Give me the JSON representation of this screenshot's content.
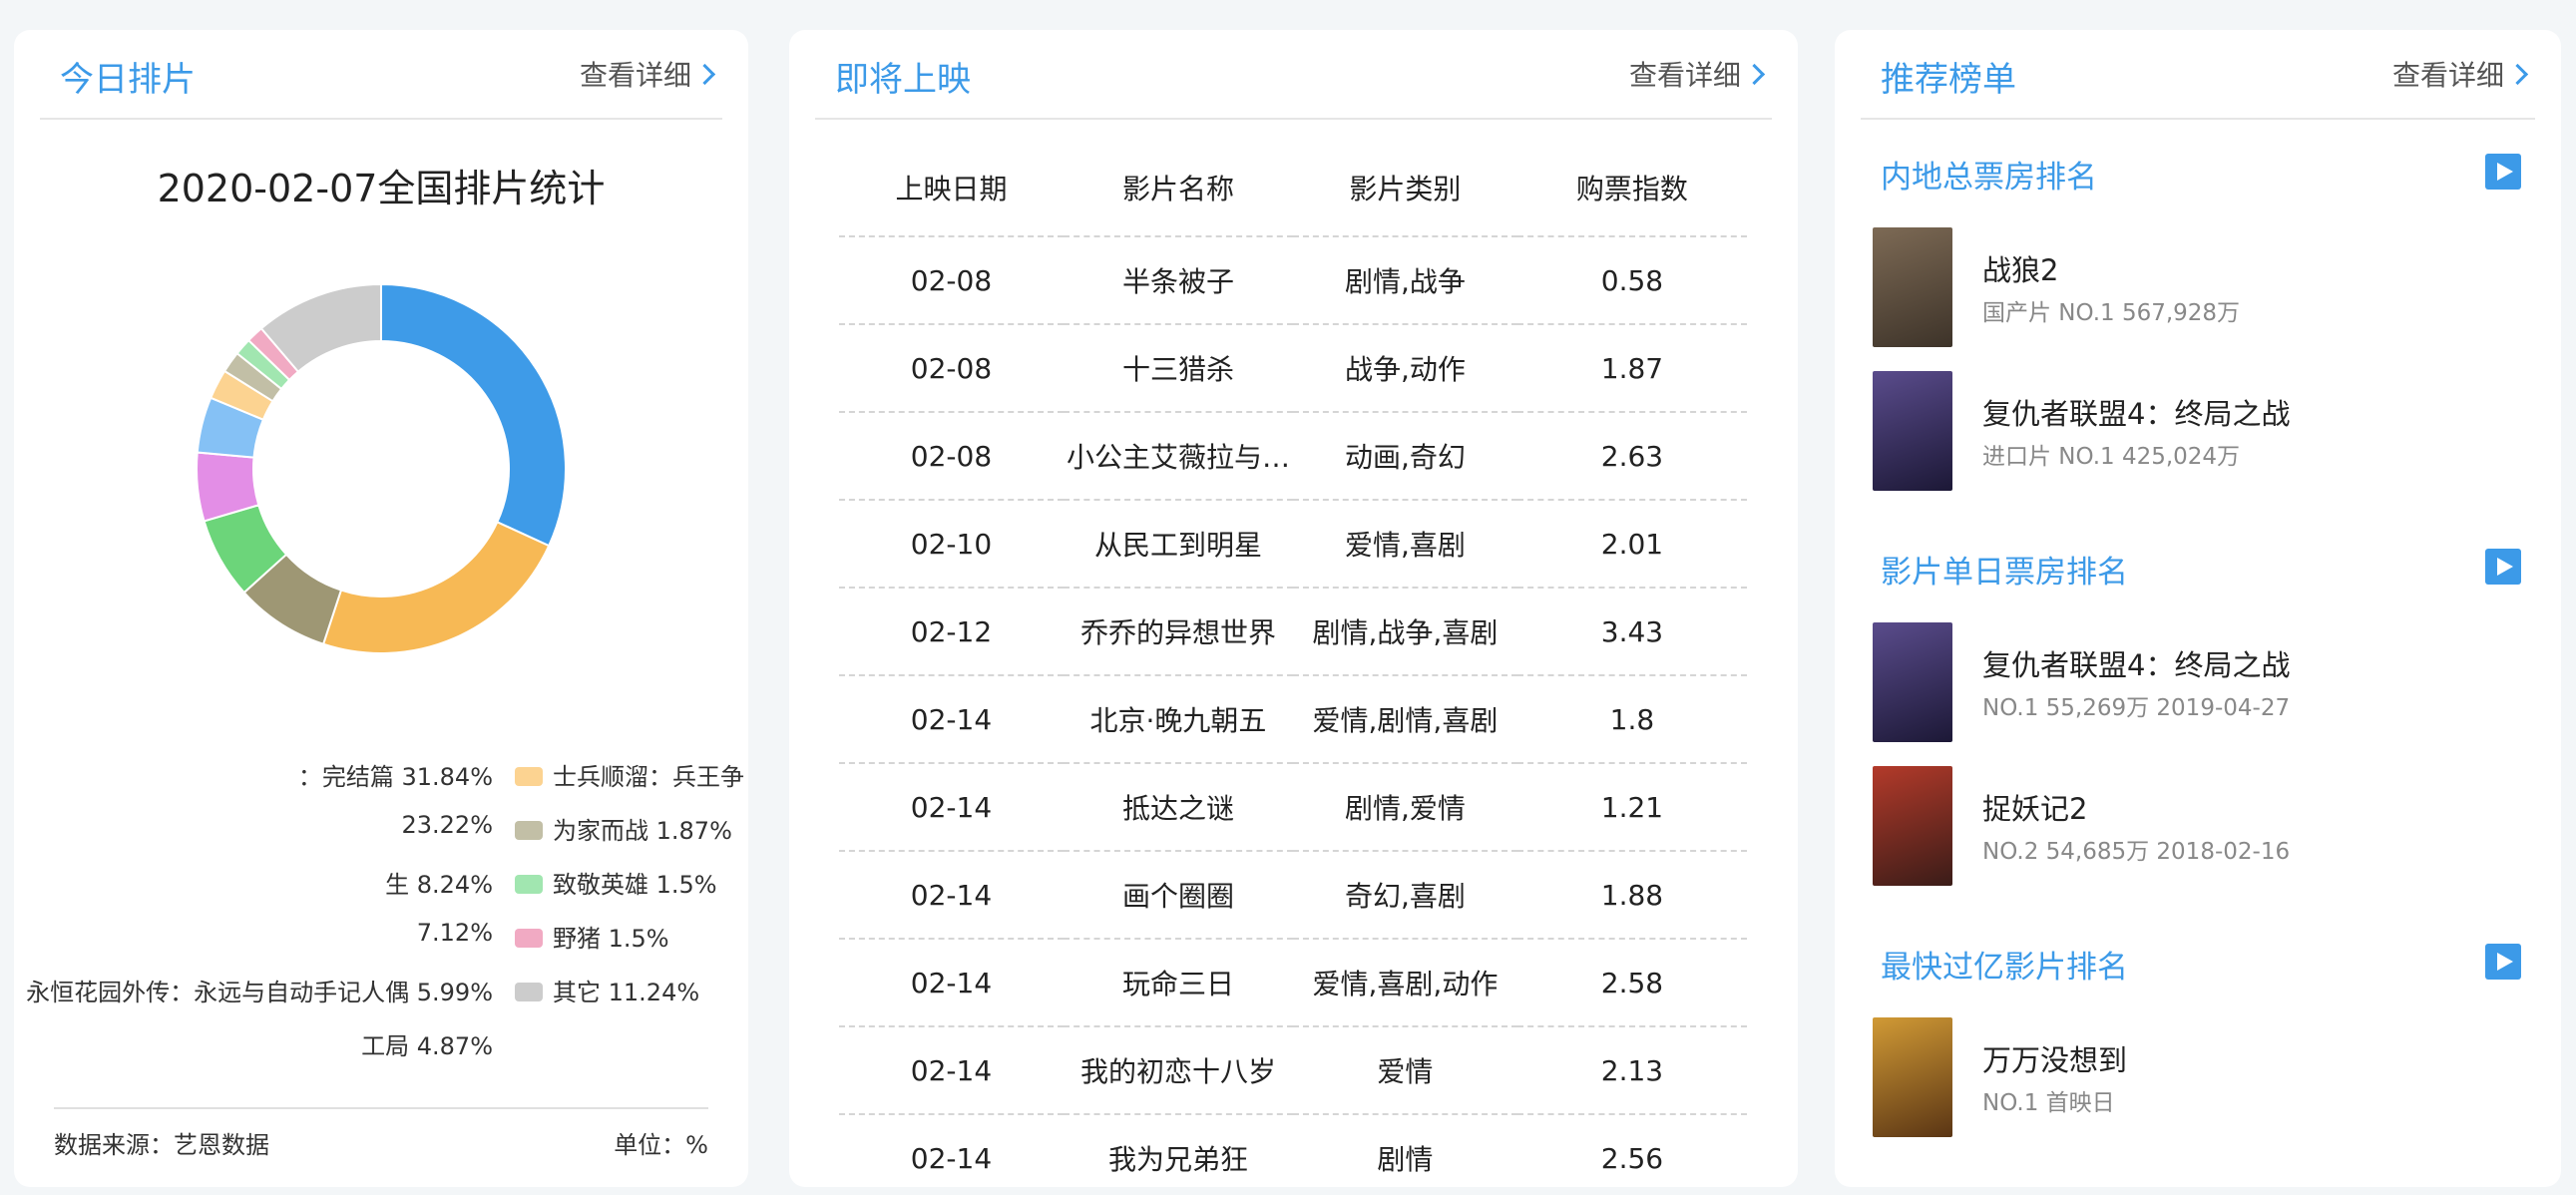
{
  "today": {
    "title": "今日排片",
    "more": "查看详细",
    "chart_title": "2020-02-07全国排片统计",
    "source": "数据来源：艺恩数据",
    "unit": "单位：%",
    "legend_left": [
      "：完结篇 31.84%",
      "23.22%",
      "生 8.24%",
      "7.12%",
      "永恒花园外传：永远与自动手记人偶 5.99%",
      "工局 4.87%"
    ],
    "legend_right": [
      "士兵顺溜：兵王争",
      "为家而战 1.87%",
      "致敬英雄 1.5%",
      "野猪 1.5%",
      "其它 11.24%"
    ]
  },
  "chart_data": {
    "type": "pie",
    "title": "2020-02-07全国排片统计",
    "unit": "%",
    "values": [
      31.84,
      23.22,
      8.24,
      7.12,
      5.99,
      4.87,
      2.6,
      1.87,
      1.5,
      1.5,
      11.24
    ],
    "colors": [
      "#3e9be8",
      "#f7b955",
      "#9e9774",
      "#6cd57a",
      "#e38ee6",
      "#85c1f5",
      "#fcd391",
      "#c2bfa6",
      "#a1e6b0",
      "#f1aac3",
      "#cccccc"
    ]
  },
  "upcoming": {
    "title": "即将上映",
    "more": "查看详细",
    "headers": [
      "上映日期",
      "影片名称",
      "影片类别",
      "购票指数"
    ],
    "rows": [
      [
        "02-08",
        "半条被子",
        "剧情,战争",
        "0.58"
      ],
      [
        "02-08",
        "十三猎杀",
        "战争,动作",
        "1.87"
      ],
      [
        "02-08",
        "小公主艾薇拉与…",
        "动画,奇幻",
        "2.63"
      ],
      [
        "02-10",
        "从民工到明星",
        "爱情,喜剧",
        "2.01"
      ],
      [
        "02-12",
        "乔乔的异想世界",
        "剧情,战争,喜剧",
        "3.43"
      ],
      [
        "02-14",
        "北京·晚九朝五",
        "爱情,剧情,喜剧",
        "1.8"
      ],
      [
        "02-14",
        "抵达之谜",
        "剧情,爱情",
        "1.21"
      ],
      [
        "02-14",
        "画个圈圈",
        "奇幻,喜剧",
        "1.88"
      ],
      [
        "02-14",
        "玩命三日",
        "爱情,喜剧,动作",
        "2.58"
      ],
      [
        "02-14",
        "我的初恋十八岁",
        "爱情",
        "2.13"
      ],
      [
        "02-14",
        "我为兄弟狂",
        "剧情",
        "2.56"
      ]
    ]
  },
  "recommend": {
    "title": "推荐榜单",
    "more": "查看详细",
    "sections": [
      {
        "title": "内地总票房排名",
        "items": [
          {
            "name": "战狼2",
            "sub": "国产片 NO.1 567,928万",
            "colors": [
              "#7d6a55",
              "#3d3329"
            ]
          },
          {
            "name": "复仇者联盟4：终局之战",
            "sub": "进口片 NO.1 425,024万",
            "colors": [
              "#5a4c8c",
              "#1c1836"
            ]
          }
        ]
      },
      {
        "title": "影片单日票房排名",
        "items": [
          {
            "name": "复仇者联盟4：终局之战",
            "sub": "NO.1 55,269万 2019-04-27",
            "colors": [
              "#5a4c8c",
              "#1c1836"
            ]
          },
          {
            "name": "捉妖记2",
            "sub": "NO.2 54,685万 2018-02-16",
            "colors": [
              "#b33a2a",
              "#3a1c18"
            ]
          }
        ]
      },
      {
        "title": "最快过亿影片排名",
        "items": [
          {
            "name": "万万没想到",
            "sub": "NO.1 首映日",
            "colors": [
              "#d19a35",
              "#5a3514"
            ]
          }
        ]
      }
    ]
  }
}
